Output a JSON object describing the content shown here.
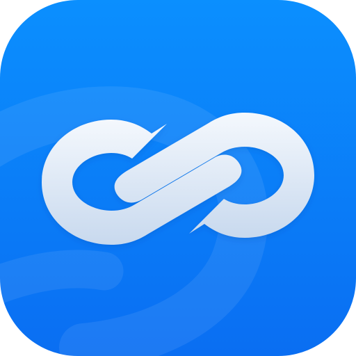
{
  "app_icon": {
    "icon": "infinity-link-icon",
    "colors": {
      "background_top": "#0b8ffe",
      "background_bottom": "#0a6ef2",
      "watermark": "#ffffff",
      "glyph_top": "#f4f8fd",
      "glyph_bottom": "#c8d9ee"
    }
  }
}
